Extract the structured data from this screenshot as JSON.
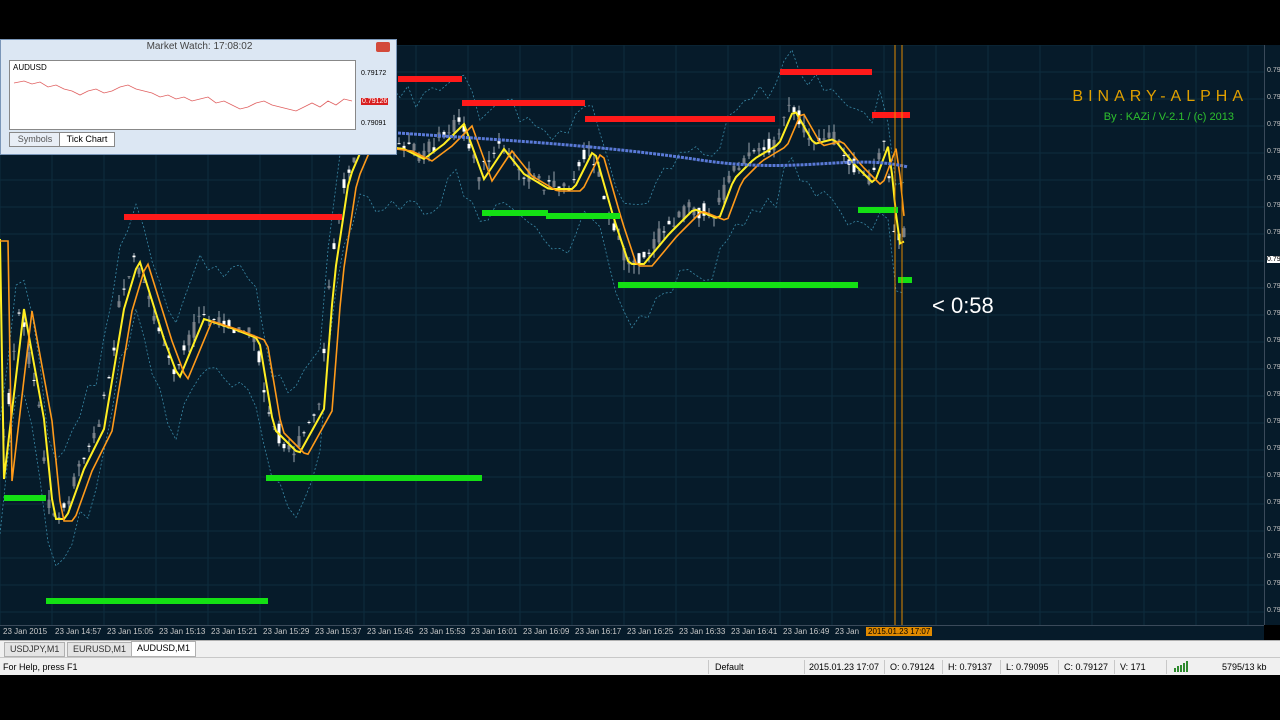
{
  "brand": {
    "title": "BINARY-ALPHA",
    "subtitle": "By : KAZi / V-2.1 / (c) 2013",
    "title_color": "#e0a000",
    "subtitle_color": "#2ec02e"
  },
  "countdown": "< 0:58",
  "market_watch": {
    "title": "Market Watch: 17:08:02",
    "symbol": "AUDUSD",
    "prices": [
      "0.79172",
      "0.79126",
      "0.79091"
    ],
    "tabs": [
      "Symbols",
      "Tick Chart"
    ],
    "active_tab": "Tick Chart"
  },
  "price_scale": {
    "labels": [
      "0.79",
      "0.79",
      "0.79",
      "0.79",
      "0.79",
      "0.79",
      "0.79",
      "0.79",
      "0.79",
      "0.79",
      "0.79",
      "0.79",
      "0.79",
      "0.79",
      "0.79",
      "0.79",
      "0.79",
      "0.79",
      "0.79",
      "0.79",
      "0.79",
      "0.79"
    ]
  },
  "time_axis": {
    "labels": [
      "23 Jan 2015",
      "23 Jan 14:57",
      "23 Jan 15:05",
      "23 Jan 15:13",
      "23 Jan 15:21",
      "23 Jan 15:29",
      "23 Jan 15:37",
      "23 Jan 15:45",
      "23 Jan 15:53",
      "23 Jan 16:01",
      "23 Jan 16:09",
      "23 Jan 16:17",
      "23 Jan 16:25",
      "23 Jan 16:33",
      "23 Jan 16:41",
      "23 Jan 16:49",
      "23 Jan"
    ],
    "cursor_label": "2015.01.23 17:07"
  },
  "chart_tabs": [
    {
      "label": "USDJPY,M1",
      "active": false
    },
    {
      "label": "EURUSD,M1",
      "active": false
    },
    {
      "label": "AUDUSD,M1",
      "active": true
    }
  ],
  "status": {
    "help": "For Help, press F1",
    "profile": "Default",
    "datetime": "2015.01.23 17:07",
    "open": "O: 0.79124",
    "high": "H: 0.79137",
    "low": "L: 0.79095",
    "close": "C: 0.79127",
    "volume": "V: 171",
    "traffic": "5795/13 kb"
  },
  "colors": {
    "chart_bg": "#061b2a",
    "resistance": "#ff1a1a",
    "support": "#14e014",
    "fast_ma": "#ffee22",
    "slow_ma": "#ff9a1a",
    "long_ma": "#5a7ad8",
    "bands": "#3a8aa8",
    "cursor": "#e08a00"
  }
}
